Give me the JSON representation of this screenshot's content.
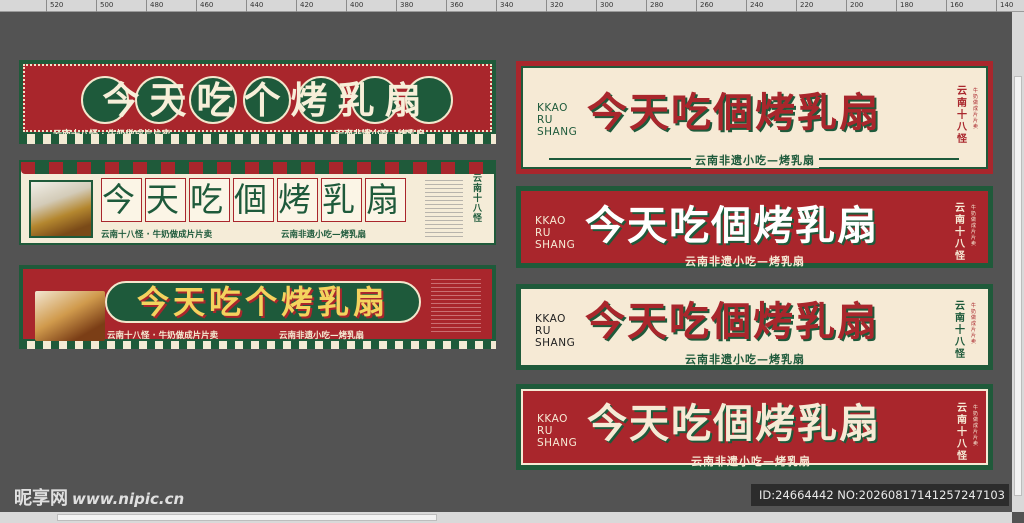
{
  "ruler": {
    "labels": [
      "520",
      "500",
      "480",
      "460",
      "440",
      "420",
      "400",
      "380",
      "360",
      "340",
      "320",
      "300",
      "280",
      "260",
      "240",
      "220",
      "200",
      "180",
      "160",
      "140"
    ]
  },
  "left_banners": {
    "b1": {
      "title": "今天吃个烤乳扇",
      "sub_left": "云南十八怪 · 牛奶做成片片卖",
      "sub_right": "云南非遗小吃—烤乳扇"
    },
    "b2": {
      "title_chars": [
        "今",
        "天",
        "吃",
        "個",
        "烤",
        "乳",
        "扇"
      ],
      "sub_left": "云南十八怪 · 牛奶做成片片卖",
      "sub_right": "云南非遗小吃—烤乳扇",
      "vtext": "云南十八怪"
    },
    "b3": {
      "title": "今天吃个烤乳扇",
      "sub_left": "云南十八怪 · 牛奶做成片片卖",
      "sub_right": "云南非遗小吃—烤乳扇"
    }
  },
  "right_banners": {
    "r1": {
      "kk": "KKAO RU SHANG",
      "title": "今天吃個烤乳扇",
      "sub": "云南非遗小吃—烤乳扇",
      "vtext": "云南十八怪",
      "tiny": "牛奶做成片片卖"
    },
    "r2": {
      "kk": "KKAO RU SHANG",
      "title": "今天吃個烤乳扇",
      "sub": "云南非遗小吃—烤乳扇",
      "vtext": "云南十八怪",
      "tiny": "牛奶做成片片卖"
    },
    "r3": {
      "kk": "KKAO RU SHANG",
      "title": "今天吃個烤乳扇",
      "sub": "云南非遗小吃—烤乳扇",
      "vtext": "云南十八怪",
      "tiny": "牛奶做成片片卖"
    },
    "r4": {
      "kk": "KKAO RU SHANG",
      "title": "今天吃個烤乳扇",
      "sub": "云南非遗小吃—烤乳扇",
      "vtext": "云南十八怪",
      "tiny": "牛奶做成片片卖"
    }
  },
  "watermark": {
    "brand": "昵享网",
    "domain": "www.nipic.cn"
  },
  "id_bar": "ID:24664442 NO:20260817141257247103"
}
